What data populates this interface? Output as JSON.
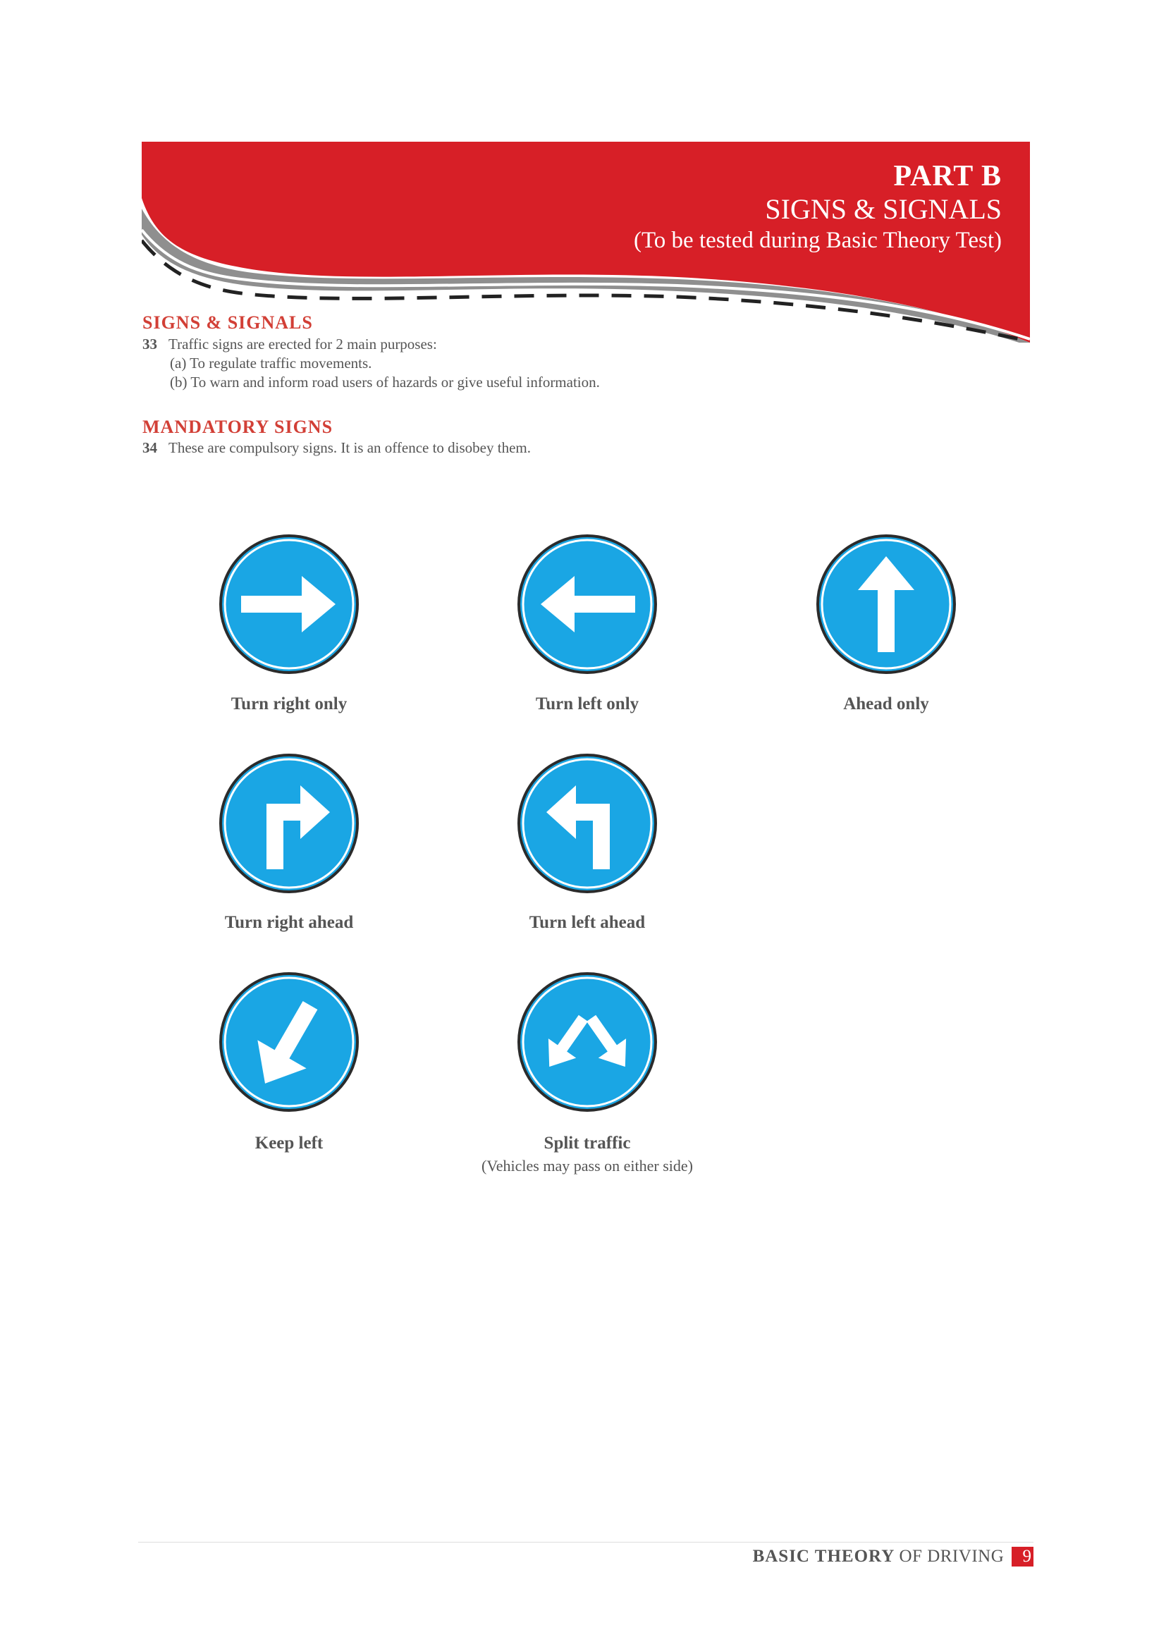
{
  "header": {
    "part": "PART B",
    "title": "SIGNS & SIGNALS",
    "subtitle": "(To be tested during Basic Theory Test)"
  },
  "section1": {
    "heading": "SIGNS & SIGNALS",
    "number": "33",
    "text": "Traffic signs are erected for 2 main purposes:",
    "items": [
      "(a)  To regulate traffic movements.",
      "(b)  To warn and inform road users of hazards or give useful information."
    ]
  },
  "section2": {
    "heading": "MANDATORY SIGNS",
    "number": "34",
    "text": "These are compulsory signs. It is an offence to disobey them."
  },
  "signs": [
    {
      "icon": "arrow-right-icon",
      "caption": "Turn right only"
    },
    {
      "icon": "arrow-left-icon",
      "caption": "Turn left only"
    },
    {
      "icon": "arrow-up-icon",
      "caption": "Ahead only"
    },
    {
      "icon": "turn-right-ahead-icon",
      "caption": "Turn right ahead"
    },
    {
      "icon": "turn-left-ahead-icon",
      "caption": "Turn left ahead"
    },
    {
      "icon": "keep-left-icon",
      "caption": "Keep left"
    },
    {
      "icon": "split-traffic-icon",
      "caption": "Split traffic",
      "note": "(Vehicles may pass on either side)"
    }
  ],
  "footer": {
    "bold": "BASIC THEORY",
    "light": "OF DRIVING",
    "page": "9"
  },
  "colors": {
    "banner_red": "#d71f27",
    "heading_red": "#d23f36",
    "sign_blue": "#1aa6e4"
  }
}
